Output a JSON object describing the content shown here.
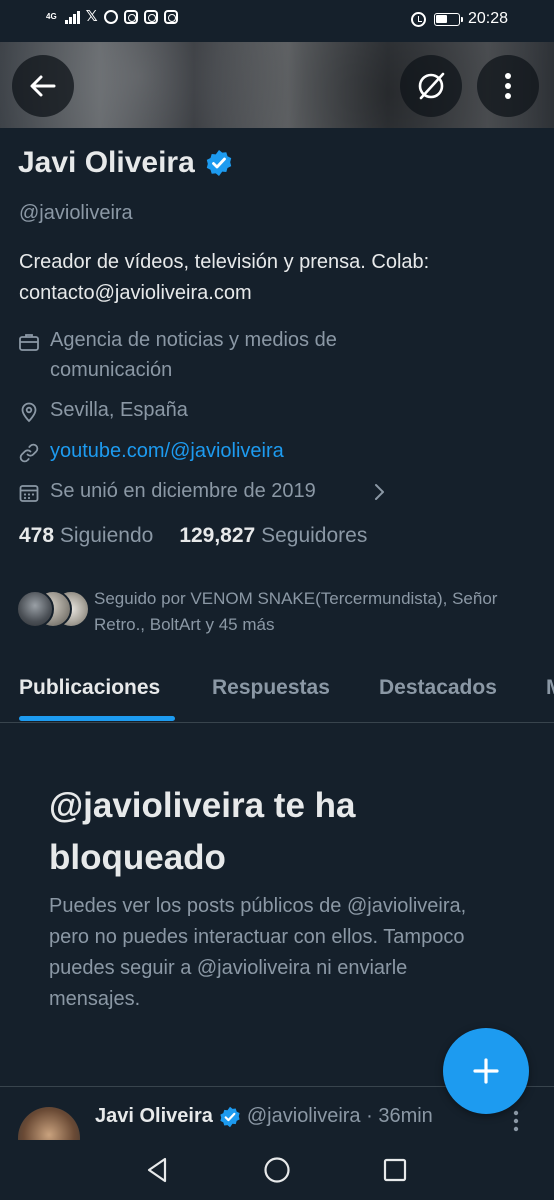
{
  "status_bar": {
    "network": "4G",
    "time": "20:28"
  },
  "header": {
    "back_icon": "arrow-left-icon",
    "grok_icon": "grok-icon",
    "more_icon": "more-vertical-icon"
  },
  "profile": {
    "name": "Javi Oliveira",
    "verified": true,
    "handle": "@javioliveira",
    "bio": "Creador de vídeos, televisión y prensa. Colab: contacto@javioliveira.com",
    "category": "Agencia de noticias y medios de comunicación",
    "location": "Sevilla, España",
    "link": "youtube.com/@javioliveira",
    "joined": "Se unió en diciembre de 2019",
    "following_count": "478",
    "following_label": "Siguiendo",
    "followers_count": "129,827",
    "followers_label": "Seguidores",
    "followed_by": "Seguido por VENOM SNAKE(Tercermundista), Señor Retro., BoltArt y 45 más"
  },
  "tabs": [
    "Publicaciones",
    "Respuestas",
    "Destacados",
    "M"
  ],
  "blocked": {
    "title": "@javioliveira te ha bloqueado",
    "body": "Puedes ver los posts públicos de @javioliveira, pero no puedes interactuar con ellos. Tampoco puedes seguir a @javioliveira ni enviarle mensajes."
  },
  "post": {
    "name": "Javi Oliveira",
    "meta": "@javioliveira · 36min"
  },
  "colors": {
    "background": "#15202b",
    "accent": "#1d9bf0",
    "secondary_text": "#8b98a5",
    "primary_text": "#e7e9ea"
  }
}
